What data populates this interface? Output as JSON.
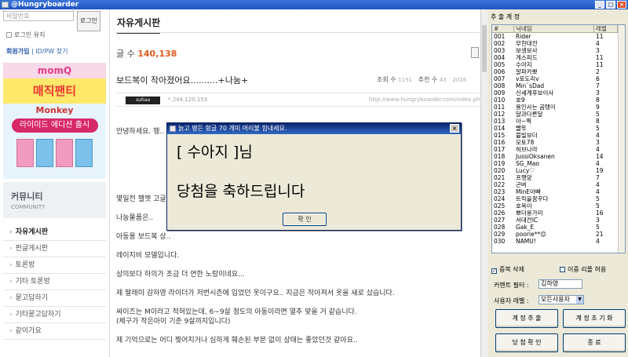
{
  "window": {
    "title": "@Hungryboarder"
  },
  "login": {
    "password_placeholder": "비밀번호",
    "login_button": "로그인",
    "keep_login": "로그인 유지",
    "join": "회원가입",
    "find": "ID/PW 찾기"
  },
  "ad": {
    "brand": "momQ",
    "headline": "매직팬티",
    "sub": "Monkey",
    "pill": "라이미드 에디션 출시"
  },
  "community": {
    "title": "커뮤니티",
    "subtitle": "COMMUNITY"
  },
  "menu": [
    "자유게시판",
    "펀글게시판",
    "토론방",
    "기타 토론방",
    "묻고답하기",
    "기타묻고답하기",
    "같이가요"
  ],
  "board": {
    "title": "자유게시판",
    "count_label": "글 수",
    "count_value": "140,138",
    "post_title": "보드복이 작아졌어요..........+나눔+",
    "views_label": "조회 수",
    "views": "1191",
    "likes_label": "추천 수",
    "likes": "43",
    "date": "2016",
    "ip": "*.244.120.153",
    "url": "http://www.hungryboarder.com/index.php?documen",
    "lines": [
      "안녕하세요. 헹..",
      "몇일전 헬멧 고글..",
      "나눔물품은..",
      "아동용 보드복 상..",
      "레이지비 모델입니다.",
      "상의보다 하의가 조금 더 연한 노랑이네요...",
      "제 딸래미 감하영 라이더가 저번시즌에 입었던 옷이구요..  지금은 작아져서 옷을 새로 샀습니다.",
      "싸이즈는 M이라고 적혀있는데, 6~9살 정도의 아동이라면 열추 맞을 거 같습니다.",
      "(체구가 작은아이 기준 9살까지입니다)",
      "제 기억으로는 어디 찢어지거나 심하게 훼손된 부분 없이 상태는 좋았던것 같아요.."
    ]
  },
  "dialog": {
    "title": "늙고 병든 헝글 70 개미 머리불 힘내세요.",
    "line1": "[ 수아지 ]님",
    "line2": "당첨을 축하드립니다",
    "ok": "확 인"
  },
  "panel": {
    "group_label": "추 출 계 정",
    "col_no": "#",
    "col_nick": "닉네임",
    "col_level": "레벨",
    "rows": [
      [
        "001",
        "Rider",
        "11"
      ],
      [
        "002",
        "무한대전",
        "4"
      ],
      [
        "003",
        "보생보사",
        "3"
      ],
      [
        "004",
        "게스피드",
        "11"
      ],
      [
        "005",
        "수아지",
        "11"
      ],
      [
        "006",
        "알파카뽀",
        "2"
      ],
      [
        "007",
        "v포도리v",
        "6"
      ],
      [
        "008",
        "Min`sDad",
        "7"
      ],
      [
        "009",
        "신세계후보이사",
        "3"
      ],
      [
        "010",
        "호9",
        "8"
      ],
      [
        "011",
        "용인사는 곰탱이",
        "9"
      ],
      [
        "012",
        "달과다른달",
        "5"
      ],
      [
        "013",
        "아~찍",
        "8"
      ],
      [
        "014",
        "빨뚜",
        "5"
      ],
      [
        "015",
        "블빌보더",
        "4"
      ],
      [
        "016",
        "모토78",
        "3"
      ],
      [
        "017",
        "허브나라",
        "4"
      ],
      [
        "018",
        "JussiOksanen",
        "14"
      ],
      [
        "019",
        "SG_Mao",
        "4"
      ],
      [
        "020",
        "Lucy♡",
        "19"
      ],
      [
        "021",
        "프랭앙",
        "7"
      ],
      [
        "022",
        "곤버",
        "4"
      ],
      [
        "023",
        "MinE아빠",
        "4"
      ],
      [
        "024",
        "트릭을꿈꾸다",
        "5"
      ],
      [
        "025",
        "호옥이",
        "5"
      ],
      [
        "026",
        "뽀더용가리",
        "16"
      ],
      [
        "027",
        "서대전IC",
        "3"
      ],
      [
        "028",
        "Gak_E",
        "5"
      ],
      [
        "029",
        "poorie**😊",
        "21"
      ],
      [
        "030",
        "NAMU!",
        "4"
      ]
    ],
    "dup_delete": "중복 삭제",
    "dup_allow": "이중 리플 허용",
    "filter_label": "커멘트 필터 :",
    "filter_value": "김하영",
    "level_label": "사용자 레벨 :",
    "level_value": "모든사용자",
    "extract_button": "계 정 추 출",
    "reset_button": "계 정 초 기 화",
    "confirm_button": "당 첨 확 인",
    "exit_button": "종 료"
  }
}
